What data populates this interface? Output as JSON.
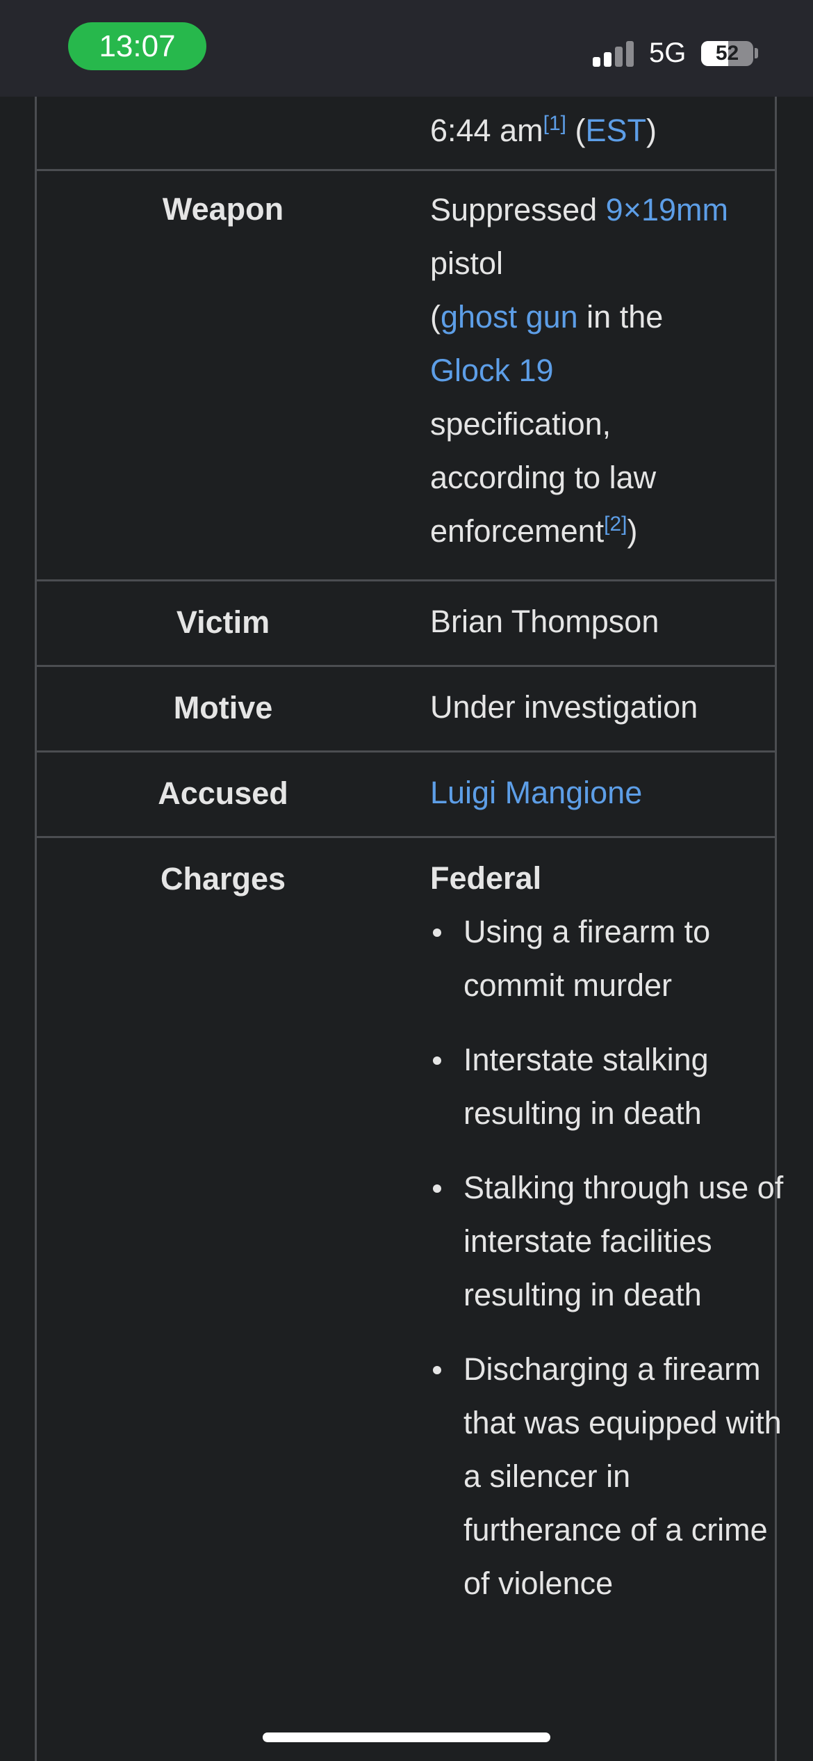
{
  "status_bar": {
    "time": "13:07",
    "network": "5G",
    "battery": "52",
    "battery_level_percent": 52
  },
  "infobox": {
    "time_row": {
      "value_text": "6:44 am",
      "ref": "[1]",
      "open_paren": "(",
      "timezone_link": "EST",
      "close_paren": ")"
    },
    "weapon": {
      "label": "Weapon",
      "line1_text": "Suppressed ",
      "caliber_link": "9×19mm",
      "line2": "pistol",
      "open_paren": "(",
      "ghost_gun_link": "ghost gun",
      "in_the": " in the",
      "glock_link": "Glock 19",
      "line5": "specification,",
      "line6": "according to law",
      "line7": "enforcement",
      "ref": "[2]",
      "close_paren": ")"
    },
    "victim": {
      "label": "Victim",
      "value": "Brian Thompson"
    },
    "motive": {
      "label": "Motive",
      "value": "Under investigation"
    },
    "accused": {
      "label": "Accused",
      "value": "Luigi Mangione"
    },
    "charges": {
      "label": "Charges",
      "heading": "Federal",
      "items": [
        "Using a firearm to commit murder",
        "Interstate stalking resulting in death",
        "Stalking through use of interstate facilities resulting in death",
        "Discharging a firearm that was equipped with a silencer in furtherance of a crime of violence"
      ]
    }
  },
  "colors": {
    "background": "#1d1f21",
    "status_bar": "#26272d",
    "time_pill": "#27b84c",
    "link": "#5d9ee7",
    "border": "#4b4d51",
    "text": "#e5e5e5"
  }
}
